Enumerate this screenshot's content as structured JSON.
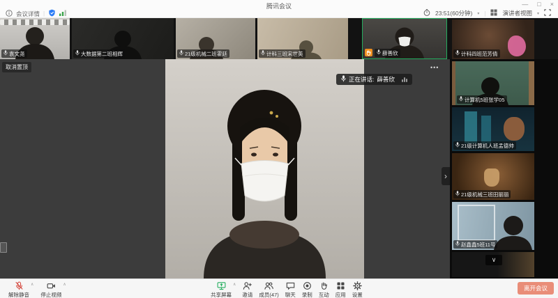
{
  "window": {
    "title": "腾讯会议",
    "minimize": "—",
    "maximize": "□",
    "close": "×"
  },
  "header": {
    "details": "会议详情",
    "duration": "23:51(60分钟)",
    "view_mode": "演讲者视图",
    "caret": "▾"
  },
  "top_row": [
    {
      "name": "袁文尧"
    },
    {
      "name": "大数据第二班相辉"
    },
    {
      "name": "21级机械二班霍廷"
    },
    {
      "name": "计科三班宋世英"
    },
    {
      "name": "薛善欣",
      "active": true,
      "hand_raised": true
    }
  ],
  "sidebar": [
    {
      "name": "计科四班范芳倩"
    },
    {
      "name": "计算机5班张学05"
    },
    {
      "name": "21级计算机人班孟德帅"
    },
    {
      "name": "21级机械三班田丽丽"
    },
    {
      "name": "赵鑫鑫5班11号"
    }
  ],
  "stage": {
    "unpin": "取消置顶",
    "more": "•••",
    "speaking_prefix": "正在讲话:",
    "speaking_name": "薛善欣",
    "expand": "›",
    "scroll_more": "∨"
  },
  "toolbar": {
    "mute": "解除静音",
    "video": "停止视频",
    "share": "共享屏幕",
    "invite": "邀请",
    "members": "成员(47)",
    "chat": "聊天",
    "record": "录制",
    "interact": "互动",
    "apps": "应用",
    "settings": "设置",
    "leave": "离开会议",
    "caret_up": "∧"
  },
  "colors": {
    "active_border": "#23ad5e",
    "hand_badge": "#f08f1f",
    "leave_button": "#e98d78",
    "mute_red": "#d5493f",
    "share_green": "#27ae60",
    "shield_blue": "#2b7cf6"
  }
}
